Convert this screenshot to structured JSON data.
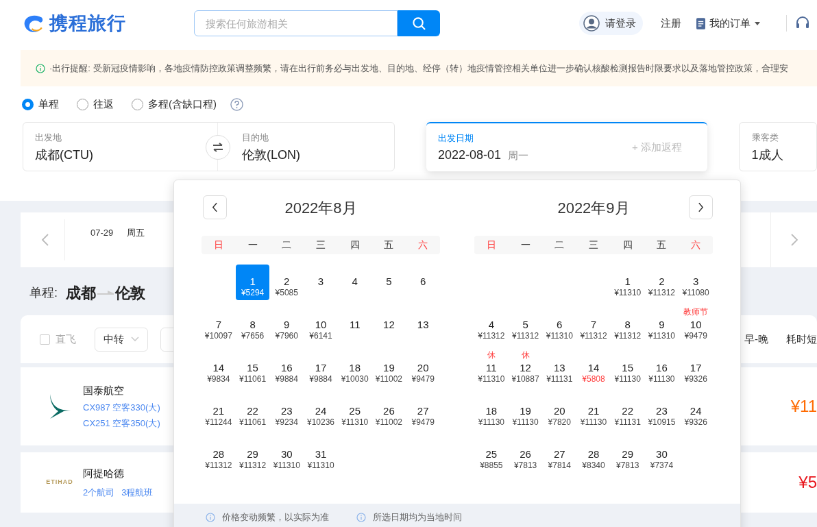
{
  "header": {
    "logo": "携程旅行",
    "search": {
      "placeholder": "搜索任何旅游相关"
    },
    "login": "请登录",
    "register": "注册",
    "orders": "我的订单"
  },
  "notice": "·出行提醒: 受新冠疫情影响，各地疫情防控政策调整频繁，请在出行前务必与出发地、目的地、经停（转）地疫情管控相关单位进一步确认核酸检测报告时限要求以及落地管控政策，合理安",
  "trip_types": [
    {
      "label": "单程",
      "selected": true
    },
    {
      "label": "往返",
      "selected": false
    },
    {
      "label": "多程(含缺口程)",
      "selected": false
    }
  ],
  "form": {
    "from": {
      "label": "出发地",
      "value": "成都(CTU)"
    },
    "to": {
      "label": "目的地",
      "value": "伦敦(LON)"
    },
    "date": {
      "label": "出发日期",
      "value": "2022-08-01",
      "weekday": "周一",
      "add_return": "+ 添加返程"
    },
    "passengers": {
      "label": "乘客类",
      "value": "1成人"
    }
  },
  "date_strip": {
    "items": [
      {
        "date": "07-29",
        "weekday": "周五"
      }
    ]
  },
  "route": {
    "prefix": "单程:",
    "from": "成都",
    "to": "伦敦"
  },
  "filters": {
    "direct": {
      "label": "直飞",
      "checked": false
    },
    "transfer": "中转",
    "sorts": [
      "早-晚",
      "耗时短"
    ]
  },
  "flights": [
    {
      "kind": "swoosh",
      "airline": "国泰航空",
      "details": [
        "CX987 空客330(大)",
        "CX251 空客350(大)"
      ],
      "price": "¥11",
      "color": "#ff6a00"
    },
    {
      "kind": "wordmark",
      "logo_text": "ETIHAD",
      "airline": "阿提哈德",
      "details": [
        "2个航司",
        "3程航班"
      ],
      "price": "¥5",
      "color": "#e8141b"
    }
  ],
  "calendar": {
    "months": [
      {
        "title": "2022年8月",
        "weekdays": [
          {
            "label": "日",
            "weekend": true
          },
          {
            "label": "一",
            "weekend": false
          },
          {
            "label": "二",
            "weekend": false
          },
          {
            "label": "三",
            "weekend": false
          },
          {
            "label": "四",
            "weekend": false
          },
          {
            "label": "五",
            "weekend": false
          },
          {
            "label": "六",
            "weekend": true
          }
        ],
        "weeks": [
          [
            {
              "kind": "blank"
            },
            {
              "day": "1",
              "price": "¥5294",
              "selected": true,
              "low": false
            },
            {
              "day": "2",
              "price": "¥5085",
              "selected": false,
              "low": false
            },
            {
              "day": "3",
              "selected": false
            },
            {
              "day": "4",
              "selected": false
            },
            {
              "day": "5",
              "selected": false
            },
            {
              "day": "6",
              "selected": false
            }
          ],
          [
            {
              "day": "7",
              "price": "¥10097",
              "selected": false,
              "low": false
            },
            {
              "day": "8",
              "price": "¥7656",
              "selected": false,
              "low": false
            },
            {
              "day": "9",
              "price": "¥7960",
              "selected": false,
              "low": false
            },
            {
              "day": "10",
              "price": "¥6141",
              "selected": false,
              "low": false
            },
            {
              "day": "11",
              "selected": false
            },
            {
              "day": "12",
              "selected": false
            },
            {
              "day": "13",
              "selected": false
            }
          ],
          [
            {
              "day": "14",
              "price": "¥9834",
              "selected": false,
              "low": false
            },
            {
              "day": "15",
              "price": "¥11061",
              "selected": false,
              "low": false
            },
            {
              "day": "16",
              "price": "¥9884",
              "selected": false,
              "low": false
            },
            {
              "day": "17",
              "price": "¥9884",
              "selected": false,
              "low": false
            },
            {
              "day": "18",
              "price": "¥10030",
              "selected": false,
              "low": false
            },
            {
              "day": "19",
              "price": "¥11002",
              "selected": false,
              "low": false
            },
            {
              "day": "20",
              "price": "¥9479",
              "selected": false,
              "low": false
            }
          ],
          [
            {
              "day": "21",
              "price": "¥11244",
              "selected": false,
              "low": false
            },
            {
              "day": "22",
              "price": "¥11061",
              "selected": false,
              "low": false
            },
            {
              "day": "23",
              "price": "¥9234",
              "selected": false,
              "low": false
            },
            {
              "day": "24",
              "price": "¥10236",
              "selected": false,
              "low": false
            },
            {
              "day": "25",
              "price": "¥11310",
              "selected": false,
              "low": false
            },
            {
              "day": "26",
              "price": "¥11002",
              "selected": false,
              "low": false
            },
            {
              "day": "27",
              "price": "¥9479",
              "selected": false,
              "low": false
            }
          ],
          [
            {
              "day": "28",
              "price": "¥11312",
              "selected": false,
              "low": false
            },
            {
              "day": "29",
              "price": "¥11312",
              "selected": false,
              "low": false
            },
            {
              "day": "30",
              "price": "¥11310",
              "selected": false,
              "low": false
            },
            {
              "day": "31",
              "price": "¥11310",
              "selected": false,
              "low": false
            }
          ]
        ]
      },
      {
        "title": "2022年9月",
        "weekdays": [
          {
            "label": "日",
            "weekend": true
          },
          {
            "label": "一",
            "weekend": false
          },
          {
            "label": "二",
            "weekend": false
          },
          {
            "label": "三",
            "weekend": false
          },
          {
            "label": "四",
            "weekend": false
          },
          {
            "label": "五",
            "weekend": false
          },
          {
            "label": "六",
            "weekend": true
          }
        ],
        "weeks": [
          [
            {
              "kind": "blank"
            },
            {
              "kind": "blank"
            },
            {
              "kind": "blank"
            },
            {
              "kind": "blank"
            },
            {
              "day": "1",
              "price": "¥11310",
              "selected": false,
              "low": false
            },
            {
              "day": "2",
              "price": "¥11312",
              "selected": false,
              "low": false
            },
            {
              "day": "3",
              "price": "¥11080",
              "selected": false,
              "low": false
            }
          ],
          [
            {
              "day": "4",
              "price": "¥11312",
              "selected": false,
              "low": false
            },
            {
              "day": "5",
              "price": "¥11312",
              "selected": false,
              "low": false
            },
            {
              "day": "6",
              "price": "¥11310",
              "selected": false,
              "low": false
            },
            {
              "day": "7",
              "price": "¥11312",
              "selected": false,
              "low": false
            },
            {
              "day": "8",
              "price": "¥11312",
              "selected": false,
              "low": false
            },
            {
              "day": "9",
              "price": "¥11310",
              "selected": false,
              "low": false
            },
            {
              "day": "10",
              "price": "¥9479",
              "selected": false,
              "low": false,
              "note": "教师节"
            }
          ],
          [
            {
              "day": "11",
              "price": "¥11310",
              "selected": false,
              "low": false,
              "note": "休"
            },
            {
              "day": "12",
              "price": "¥10887",
              "selected": false,
              "low": false,
              "note": "休"
            },
            {
              "day": "13",
              "price": "¥11131",
              "selected": false,
              "low": false
            },
            {
              "day": "14",
              "price": "¥5808",
              "selected": false,
              "low": true
            },
            {
              "day": "15",
              "price": "¥11130",
              "selected": false,
              "low": false
            },
            {
              "day": "16",
              "price": "¥11130",
              "selected": false,
              "low": false
            },
            {
              "day": "17",
              "price": "¥9326",
              "selected": false,
              "low": false
            }
          ],
          [
            {
              "day": "18",
              "price": "¥11130",
              "selected": false,
              "low": false
            },
            {
              "day": "19",
              "price": "¥11130",
              "selected": false,
              "low": false
            },
            {
              "day": "20",
              "price": "¥7820",
              "selected": false,
              "low": false
            },
            {
              "day": "21",
              "price": "¥11130",
              "selected": false,
              "low": false
            },
            {
              "day": "22",
              "price": "¥11131",
              "selected": false,
              "low": false
            },
            {
              "day": "23",
              "price": "¥10915",
              "selected": false,
              "low": false
            },
            {
              "day": "24",
              "price": "¥9326",
              "selected": false,
              "low": false
            }
          ],
          [
            {
              "day": "25",
              "price": "¥8855",
              "selected": false,
              "low": false
            },
            {
              "day": "26",
              "price": "¥7813",
              "selected": false,
              "low": false
            },
            {
              "day": "27",
              "price": "¥7814",
              "selected": false,
              "low": false
            },
            {
              "day": "28",
              "price": "¥8340",
              "selected": false,
              "low": false
            },
            {
              "day": "29",
              "price": "¥7813",
              "selected": false,
              "low": false
            },
            {
              "day": "30",
              "price": "¥7374",
              "selected": false,
              "low": false
            }
          ]
        ]
      }
    ],
    "footer": [
      "价格变动频繁，以实际为准",
      "所选日期均为当地时间"
    ]
  }
}
